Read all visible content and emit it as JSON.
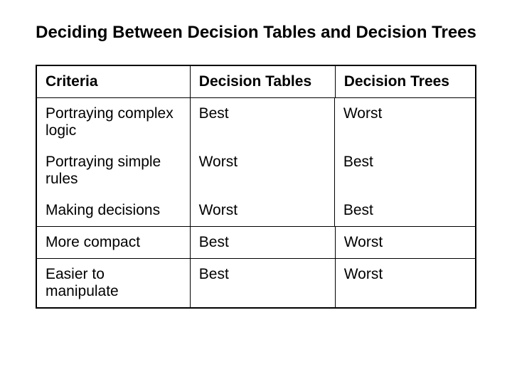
{
  "title": "Deciding Between Decision Tables and Decision Trees",
  "headers": {
    "criteria": "Criteria",
    "tables": "Decision Tables",
    "trees": "Decision Trees"
  },
  "block1": {
    "r1": {
      "criteria": "Portraying complex logic",
      "tables": "Best",
      "trees": "Worst"
    },
    "r2": {
      "criteria": "Portraying simple rules",
      "tables": "Worst",
      "trees": "Best"
    },
    "r3": {
      "criteria": "Making decisions",
      "tables": "Worst",
      "trees": "Best"
    }
  },
  "row_compact": {
    "criteria": "More compact",
    "tables": "Best",
    "trees": "Worst"
  },
  "row_manipulate": {
    "criteria": "Easier to manipulate",
    "tables": "Best",
    "trees": "Worst"
  }
}
